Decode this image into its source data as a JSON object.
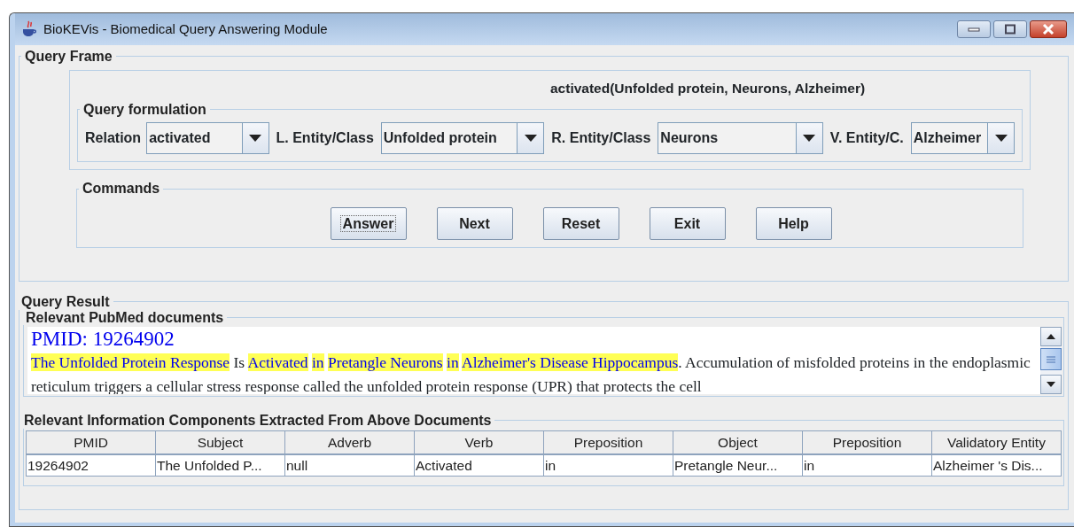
{
  "window": {
    "title": "BioKEVis - Biomedical Query Answering Module"
  },
  "query_frame": {
    "title": "Query Frame",
    "query_expression": "activated(Unfolded protein, Neurons, Alzheimer)",
    "formulation": {
      "title": "Query formulation",
      "fields": [
        {
          "label": "Relation",
          "value": "activated"
        },
        {
          "label": "L. Entity/Class",
          "value": "Unfolded protein"
        },
        {
          "label": "R. Entity/Class",
          "value": "Neurons"
        },
        {
          "label": "V. Entity/C.",
          "value": "Alzheimer"
        }
      ]
    },
    "commands": {
      "title": "Commands",
      "buttons": [
        {
          "label": "Answer",
          "focused": true
        },
        {
          "label": "Next",
          "focused": false
        },
        {
          "label": "Reset",
          "focused": false
        },
        {
          "label": "Exit",
          "focused": false
        },
        {
          "label": "Help",
          "focused": false
        }
      ]
    }
  },
  "query_result": {
    "title": "Query Result",
    "documents": {
      "title": "Relevant PubMed documents",
      "heading": "PMID: 19264902",
      "segments": [
        {
          "text": "The Unfolded Protein Response",
          "highlighted": true
        },
        {
          "text": "Is",
          "highlighted": false
        },
        {
          "text": "Activated",
          "highlighted": true
        },
        {
          "text": "in",
          "highlighted": true
        },
        {
          "text": "Pretangle Neurons",
          "highlighted": true
        },
        {
          "text": "in",
          "highlighted": true
        },
        {
          "text": "Alzheimer's Disease Hippocampus",
          "highlighted": true
        },
        {
          "text": ". Accumulation of misfolded proteins in the endoplasmic reticulum triggers a cellular stress response called the unfolded protein response (UPR) that protects the cell",
          "highlighted": false
        }
      ]
    },
    "components": {
      "title": "Relevant Information Components Extracted From Above Documents",
      "columns": [
        "PMID",
        "Subject",
        "Adverb",
        "Verb",
        "Preposition",
        "Object",
        "Preposition",
        "Validatory Entity"
      ],
      "rows": [
        [
          "19264902",
          "The Unfolded P...",
          "null",
          "Activated",
          "in",
          "Pretangle Neur...",
          "in",
          "Alzheimer 's Dis..."
        ]
      ]
    }
  }
}
